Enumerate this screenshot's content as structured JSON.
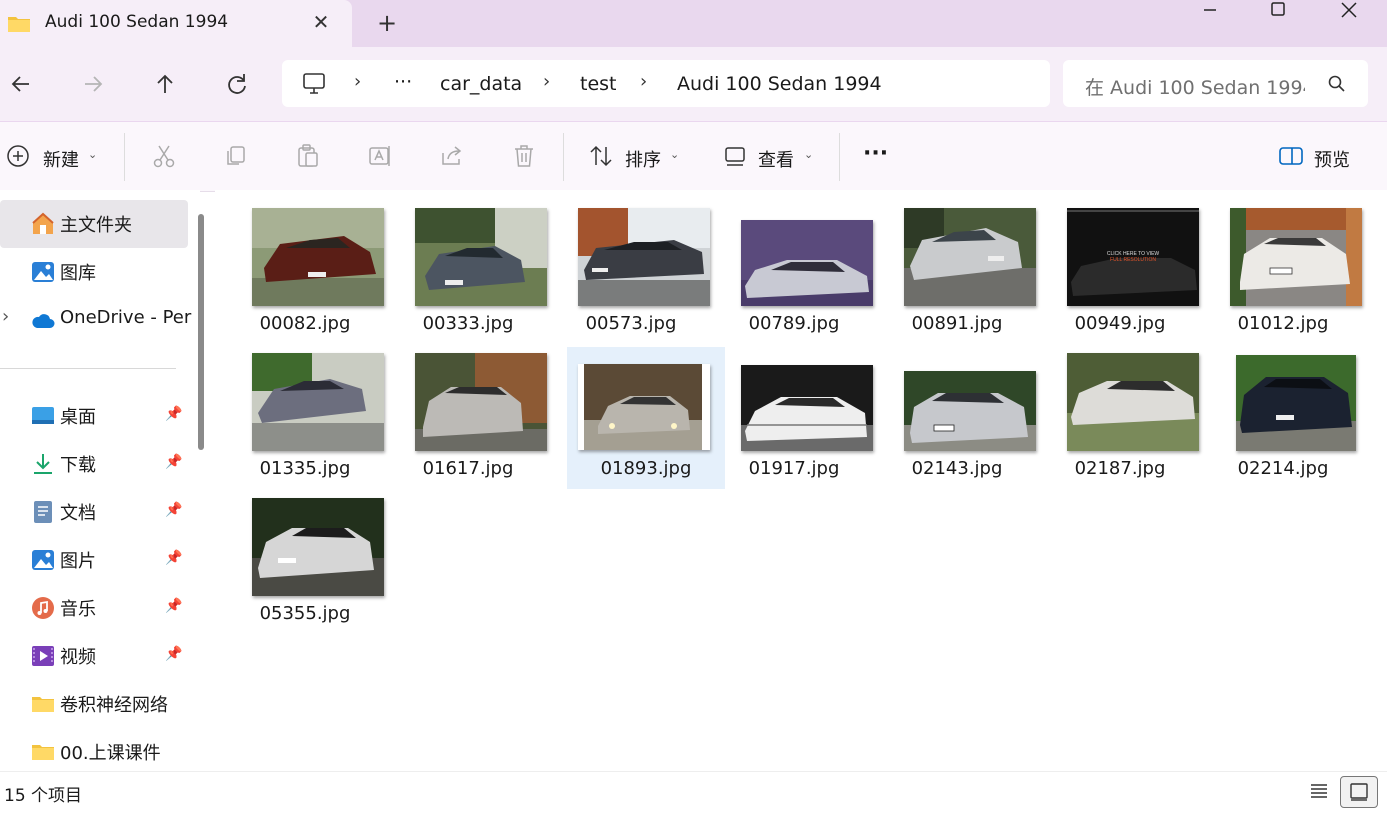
{
  "window": {
    "tab_title": "Audi 100 Sedan 1994",
    "tab_close_icon": "close-icon",
    "new_tab_icon": "plus-icon",
    "controls": [
      "minimize-icon",
      "maximize-icon",
      "close-icon"
    ]
  },
  "nav": {
    "back_icon": "arrow-left-icon",
    "forward_icon": "arrow-right-icon",
    "up_icon": "arrow-up-icon",
    "refresh_icon": "refresh-icon"
  },
  "breadcrumb": {
    "more": "···",
    "items": [
      "car_data",
      "test",
      "Audi 100 Sedan 1994"
    ]
  },
  "search": {
    "placeholder": "在 Audi 100 Sedan 1994 中搜索"
  },
  "toolbar": {
    "new_label": "新建",
    "sort_label": "排序",
    "view_label": "查看",
    "more_label": "···",
    "preview_label": "预览"
  },
  "sidebar": {
    "items": [
      {
        "label": "主文件夹",
        "icon": "home-icon"
      },
      {
        "label": "图库",
        "icon": "gallery-icon"
      },
      {
        "label": "OneDrive - Per",
        "icon": "cloud-icon"
      },
      {
        "label": "桌面",
        "icon": "desktop-icon"
      },
      {
        "label": "下载",
        "icon": "download-icon"
      },
      {
        "label": "文档",
        "icon": "document-icon"
      },
      {
        "label": "图片",
        "icon": "pictures-icon"
      },
      {
        "label": "音乐",
        "icon": "music-icon"
      },
      {
        "label": "视频",
        "icon": "video-icon"
      },
      {
        "label": "卷积神经网络",
        "icon": "folder-icon"
      },
      {
        "label": "00.上课课件",
        "icon": "folder-icon"
      }
    ]
  },
  "files": [
    {
      "name": "00082.jpg"
    },
    {
      "name": "00333.jpg"
    },
    {
      "name": "00573.jpg"
    },
    {
      "name": "00789.jpg"
    },
    {
      "name": "00891.jpg"
    },
    {
      "name": "00949.jpg"
    },
    {
      "name": "01012.jpg"
    },
    {
      "name": "01335.jpg"
    },
    {
      "name": "01617.jpg"
    },
    {
      "name": "01893.jpg"
    },
    {
      "name": "01917.jpg"
    },
    {
      "name": "02143.jpg"
    },
    {
      "name": "02187.jpg"
    },
    {
      "name": "02214.jpg"
    },
    {
      "name": "05355.jpg"
    }
  ],
  "thumb_overlay": {
    "line1": "CLICK HERE TO VIEW",
    "line2": "FULL RESOLUTION"
  },
  "status": {
    "count": "15 个项目"
  },
  "colors": {
    "titlebar": "#e9d8ee",
    "tab": "#f6eef8",
    "selection": "#e5f0fb",
    "accent": "#0067c0"
  }
}
